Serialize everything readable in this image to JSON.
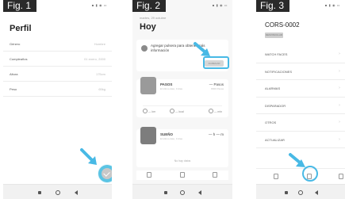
{
  "accent_color": "#48b9e5",
  "fig1": {
    "label": "Fig. 1",
    "title": "Perfil",
    "rows": [
      {
        "label": "Género",
        "value": "Hombre"
      },
      {
        "label": "Cumpleaños",
        "value": "01 enero, 2000"
      },
      {
        "label": "Altura",
        "value": "175cm"
      },
      {
        "label": "Peso",
        "value": "65kg"
      }
    ],
    "fab_icon": "check-icon"
  },
  "fig2": {
    "label": "Fig. 2",
    "subtitle": "martes, 29 octubre",
    "title": "Hoy",
    "banner_text": "Agregar pulsera para obtener más información",
    "banner_button": "AGREGAR",
    "pasos": {
      "name": "PASOS",
      "sub": "El último dato, 0 días",
      "value": "— Pasos",
      "value_sub": "8000 Pasos",
      "metrics": [
        "— km",
        "— kcal",
        "— min"
      ]
    },
    "sueno": {
      "name": "SUEÑO",
      "sub": "El último dato, 0 días",
      "value": "— h — m",
      "hint": "No hay datos"
    }
  },
  "fig3": {
    "label": "Fig. 3",
    "title": "CORS-0002",
    "badge": "DESVINCULAR",
    "rows": [
      "WATCH FACES",
      "NOTIFICACIONES",
      "ALARMAS",
      "DISPARADOR",
      "OTROS",
      "ACTUALIZAR"
    ]
  },
  "status_text": "▪ ▮ ◉ ▭"
}
